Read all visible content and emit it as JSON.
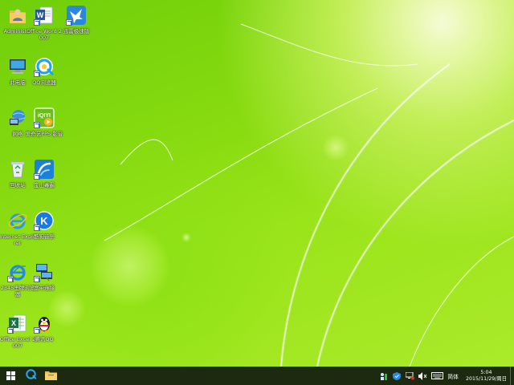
{
  "desktop": {
    "icons": [
      {
        "name": "administrator-folder",
        "label": "Administ...",
        "icon": "user-folder-icon"
      },
      {
        "name": "office-word",
        "label": "Office Word 2007",
        "icon": "word-icon"
      },
      {
        "name": "xunlei",
        "label": "迅雷极速版",
        "icon": "xunlei-bird-icon"
      },
      {
        "name": "this-pc",
        "label": "此电脑",
        "icon": "computer-icon"
      },
      {
        "name": "qq-browser",
        "label": "QQ浏览器",
        "icon": "qq-browser-icon"
      },
      {
        "name": "network",
        "label": "网络",
        "icon": "network-icon"
      },
      {
        "name": "iqiyi",
        "label": "爱奇艺PPS 影音",
        "icon": "iqiyi-icon"
      },
      {
        "name": "recycle-bin",
        "label": "回收站",
        "icon": "recycle-bin-icon"
      },
      {
        "name": "kingsoft-antivirus",
        "label": "金山毒霸",
        "icon": "antivirus-icon"
      },
      {
        "name": "internet-explorer",
        "label": "Internet Explorer",
        "icon": "ie-icon"
      },
      {
        "name": "kugou",
        "label": "酷狗音乐",
        "icon": "kugou-icon"
      },
      {
        "name": "2345-browser",
        "label": "2345王牌浏览器",
        "icon": "2345-browser-icon"
      },
      {
        "name": "broadband",
        "label": "宽带连接",
        "icon": "broadband-icon"
      },
      {
        "name": "office-excel",
        "label": "Office Excel 2007",
        "icon": "excel-icon"
      },
      {
        "name": "tencent-qq",
        "label": "腾讯QQ",
        "icon": "qq-penguin-icon"
      }
    ]
  },
  "taskbar": {
    "start_icon": "windows-start-icon",
    "pinned": [
      {
        "name": "qq-browser",
        "icon": "qq-browser-icon"
      },
      {
        "name": "file-explorer",
        "icon": "folder-icon"
      }
    ],
    "tray_icons": [
      "people-icon",
      "shield-icon",
      "network-icon",
      "volume-icon",
      "keyboard-icon"
    ],
    "ime_label": "简体",
    "time": "5:04",
    "date": "2015/11/29/周日"
  },
  "colors": {
    "taskbar_bg": "#1d2a10",
    "wallpaper_green": "#86da0f"
  }
}
